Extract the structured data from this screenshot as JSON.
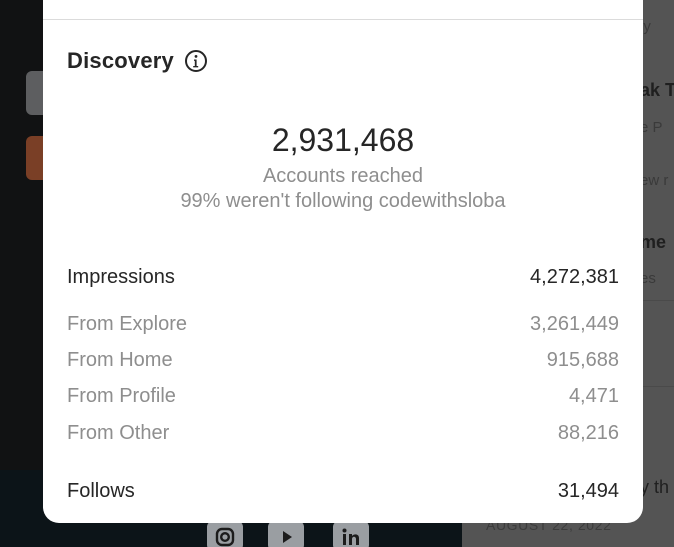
{
  "background": {
    "date": "AUGUST 22, 2022",
    "snippets": [
      "ly",
      "ak T",
      "e  P",
      "ew r",
      "me",
      "es",
      "y th"
    ]
  },
  "modal": {
    "section_title": "Discovery",
    "info_icon": "info-circle-icon",
    "accounts_reached_value": "2,931,468",
    "accounts_reached_label": "Accounts reached",
    "not_following_note": "99% weren't following codewithsloba",
    "impressions": {
      "label": "Impressions",
      "value": "4,272,381"
    },
    "impression_sources": [
      {
        "label": "From Explore",
        "value": "3,261,449"
      },
      {
        "label": "From Home",
        "value": "915,688"
      },
      {
        "label": "From Profile",
        "value": "4,471"
      },
      {
        "label": "From Other",
        "value": "88,216"
      }
    ],
    "follows": {
      "label": "Follows",
      "value": "31,494"
    }
  },
  "colors": {
    "highlight": "#ffef2e",
    "primary_text": "#262626",
    "secondary_text": "#8e8e8e"
  }
}
